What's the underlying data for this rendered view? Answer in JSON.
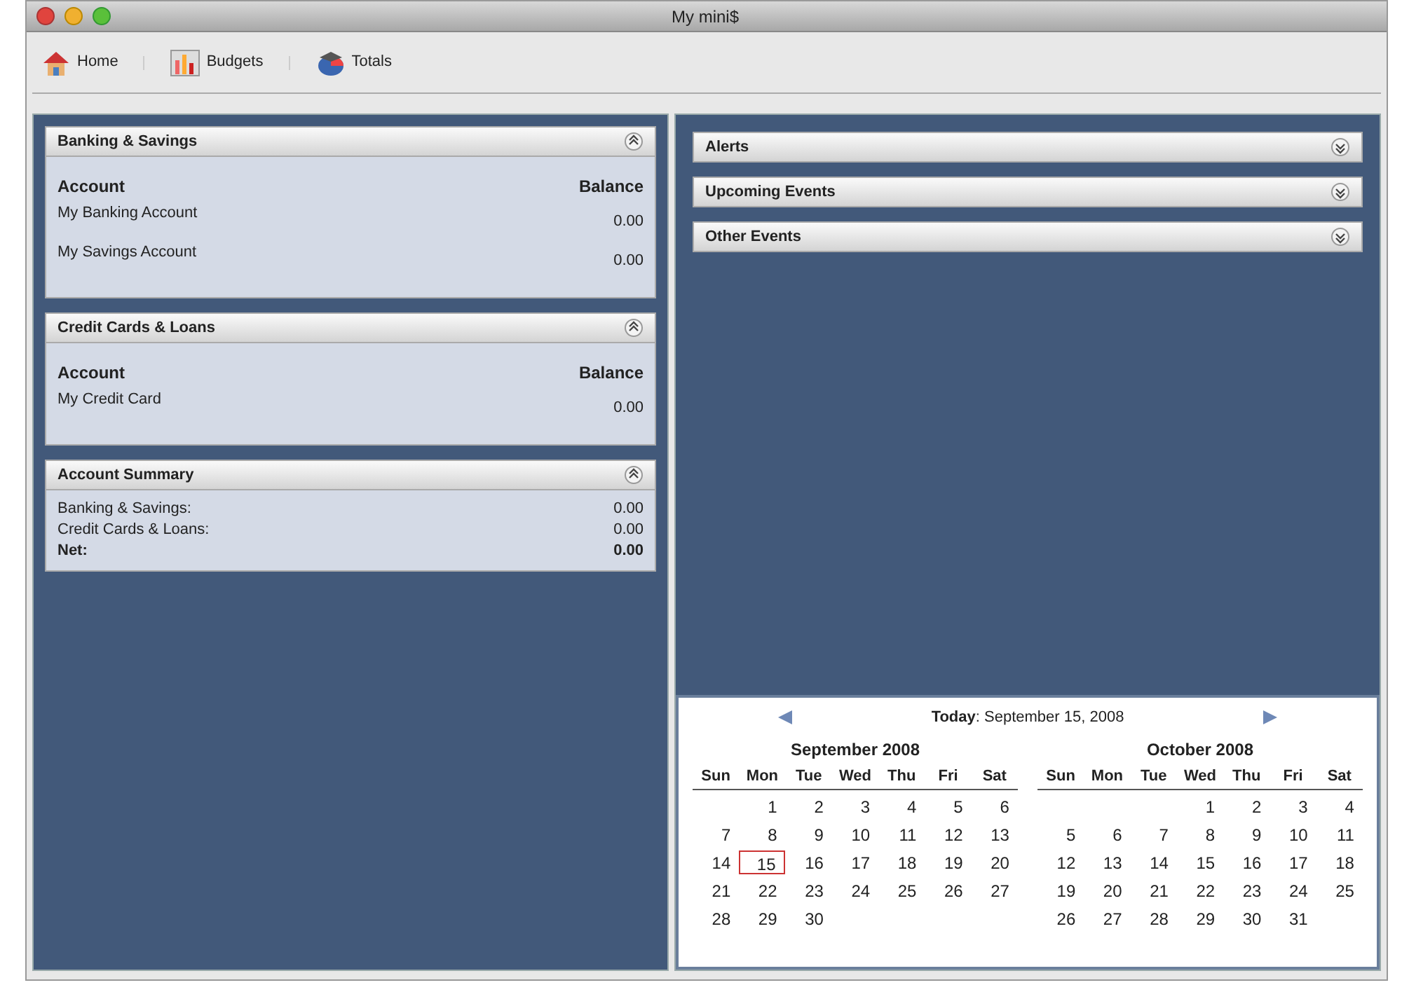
{
  "window": {
    "title": "My mini$"
  },
  "toolbar": [
    {
      "label": "Home",
      "kind": "home"
    },
    {
      "label": "Budgets",
      "kind": "budgets"
    },
    {
      "label": "Totals",
      "kind": "totals"
    }
  ],
  "left_panels": [
    {
      "title": "Banking & Savings",
      "expanded": true,
      "kind": "accounts",
      "columns": [
        "Account",
        "Balance"
      ],
      "rows": [
        {
          "name": "My Banking Account",
          "balance": "0.00"
        },
        {
          "name": "My Savings Account",
          "balance": "0.00"
        }
      ]
    },
    {
      "title": "Credit Cards & Loans",
      "expanded": true,
      "kind": "accounts",
      "columns": [
        "Account",
        "Balance"
      ],
      "rows": [
        {
          "name": "My Credit Card",
          "balance": "0.00"
        }
      ]
    },
    {
      "title": "Account Summary",
      "expanded": true,
      "kind": "summary",
      "rows": [
        {
          "label": "Banking & Savings:",
          "value": "0.00",
          "emphasis": false
        },
        {
          "label": "Credit Cards & Loans:",
          "value": "0.00",
          "emphasis": false
        },
        {
          "label": "Net:",
          "value": "0.00",
          "emphasis": true
        }
      ]
    }
  ],
  "right_panels": [
    {
      "title": "Alerts",
      "expanded": false
    },
    {
      "title": "Upcoming Events",
      "expanded": false
    },
    {
      "title": "Other Events",
      "expanded": false
    }
  ],
  "calendar": {
    "today_label": "Today",
    "today_value": ": September 15, 2008",
    "months": [
      {
        "title": "September 2008",
        "weekdays": [
          "Sun",
          "Mon",
          "Tue",
          "Wed",
          "Thu",
          "Fri",
          "Sat"
        ],
        "weeks": [
          [
            {
              "kind": "blank"
            },
            {
              "kind": "day",
              "d": "1",
              "selected": false
            },
            {
              "kind": "day",
              "d": "2",
              "selected": false
            },
            {
              "kind": "day",
              "d": "3",
              "selected": false
            },
            {
              "kind": "day",
              "d": "4",
              "selected": false
            },
            {
              "kind": "day",
              "d": "5",
              "selected": false
            },
            {
              "kind": "day",
              "d": "6",
              "selected": false
            }
          ],
          [
            {
              "kind": "day",
              "d": "7",
              "selected": false
            },
            {
              "kind": "day",
              "d": "8",
              "selected": false
            },
            {
              "kind": "day",
              "d": "9",
              "selected": false
            },
            {
              "kind": "day",
              "d": "10",
              "selected": false
            },
            {
              "kind": "day",
              "d": "11",
              "selected": false
            },
            {
              "kind": "day",
              "d": "12",
              "selected": false
            },
            {
              "kind": "day",
              "d": "13",
              "selected": false
            }
          ],
          [
            {
              "kind": "day",
              "d": "14",
              "selected": false
            },
            {
              "kind": "day",
              "d": "15",
              "selected": true
            },
            {
              "kind": "day",
              "d": "16",
              "selected": false
            },
            {
              "kind": "day",
              "d": "17",
              "selected": false
            },
            {
              "kind": "day",
              "d": "18",
              "selected": false
            },
            {
              "kind": "day",
              "d": "19",
              "selected": false
            },
            {
              "kind": "day",
              "d": "20",
              "selected": false
            }
          ],
          [
            {
              "kind": "day",
              "d": "21",
              "selected": false
            },
            {
              "kind": "day",
              "d": "22",
              "selected": false
            },
            {
              "kind": "day",
              "d": "23",
              "selected": false
            },
            {
              "kind": "day",
              "d": "24",
              "selected": false
            },
            {
              "kind": "day",
              "d": "25",
              "selected": false
            },
            {
              "kind": "day",
              "d": "26",
              "selected": false
            },
            {
              "kind": "day",
              "d": "27",
              "selected": false
            }
          ],
          [
            {
              "kind": "day",
              "d": "28",
              "selected": false
            },
            {
              "kind": "day",
              "d": "29",
              "selected": false
            },
            {
              "kind": "day",
              "d": "30",
              "selected": false
            }
          ]
        ]
      },
      {
        "title": "October 2008",
        "weekdays": [
          "Sun",
          "Mon",
          "Tue",
          "Wed",
          "Thu",
          "Fri",
          "Sat"
        ],
        "weeks": [
          [
            {
              "kind": "blank"
            },
            {
              "kind": "blank"
            },
            {
              "kind": "blank"
            },
            {
              "kind": "day",
              "d": "1",
              "selected": false
            },
            {
              "kind": "day",
              "d": "2",
              "selected": false
            },
            {
              "kind": "day",
              "d": "3",
              "selected": false
            },
            {
              "kind": "day",
              "d": "4",
              "selected": false
            }
          ],
          [
            {
              "kind": "day",
              "d": "5",
              "selected": false
            },
            {
              "kind": "day",
              "d": "6",
              "selected": false
            },
            {
              "kind": "day",
              "d": "7",
              "selected": false
            },
            {
              "kind": "day",
              "d": "8",
              "selected": false
            },
            {
              "kind": "day",
              "d": "9",
              "selected": false
            },
            {
              "kind": "day",
              "d": "10",
              "selected": false
            },
            {
              "kind": "day",
              "d": "11",
              "selected": false
            }
          ],
          [
            {
              "kind": "day",
              "d": "12",
              "selected": false
            },
            {
              "kind": "day",
              "d": "13",
              "selected": false
            },
            {
              "kind": "day",
              "d": "14",
              "selected": false
            },
            {
              "kind": "day",
              "d": "15",
              "selected": false
            },
            {
              "kind": "day",
              "d": "16",
              "selected": false
            },
            {
              "kind": "day",
              "d": "17",
              "selected": false
            },
            {
              "kind": "day",
              "d": "18",
              "selected": false
            }
          ],
          [
            {
              "kind": "day",
              "d": "19",
              "selected": false
            },
            {
              "kind": "day",
              "d": "20",
              "selected": false
            },
            {
              "kind": "day",
              "d": "21",
              "selected": false
            },
            {
              "kind": "day",
              "d": "22",
              "selected": false
            },
            {
              "kind": "day",
              "d": "23",
              "selected": false
            },
            {
              "kind": "day",
              "d": "24",
              "selected": false
            },
            {
              "kind": "day",
              "d": "25",
              "selected": false
            }
          ],
          [
            {
              "kind": "day",
              "d": "26",
              "selected": false
            },
            {
              "kind": "day",
              "d": "27",
              "selected": false
            },
            {
              "kind": "day",
              "d": "28",
              "selected": false
            },
            {
              "kind": "day",
              "d": "29",
              "selected": false
            },
            {
              "kind": "day",
              "d": "30",
              "selected": false
            },
            {
              "kind": "day",
              "d": "31",
              "selected": false
            }
          ]
        ]
      }
    ]
  }
}
